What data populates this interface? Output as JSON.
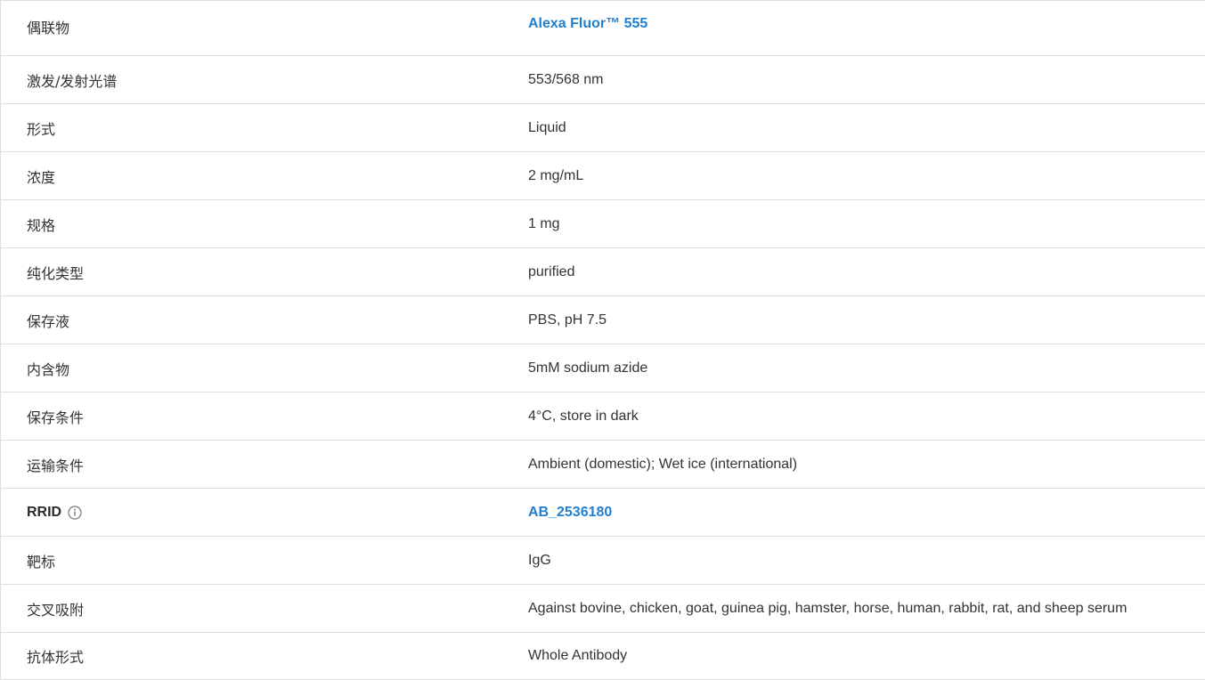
{
  "specs": [
    {
      "label": "偶联物",
      "value": "Alexa Fluor™ 555",
      "link": true
    },
    {
      "label": "激发/发射光谱",
      "value": "553/568 nm",
      "link": false
    },
    {
      "label": "形式",
      "value": "Liquid",
      "link": false
    },
    {
      "label": "浓度",
      "value": "2 mg/mL",
      "link": false
    },
    {
      "label": "规格",
      "value": "1 mg",
      "link": false
    },
    {
      "label": "纯化类型",
      "value": "purified",
      "link": false
    },
    {
      "label": "保存液",
      "value": "PBS, pH 7.5",
      "link": false
    },
    {
      "label": "内含物",
      "value": "5mM sodium azide",
      "link": false
    },
    {
      "label": "保存条件",
      "value": "4°C, store in dark",
      "link": false
    },
    {
      "label": "运输条件",
      "value": "Ambient (domestic); Wet ice (international)",
      "link": false
    },
    {
      "label": "RRID",
      "value": "AB_2536180",
      "link": true,
      "info_icon": "info-icon"
    },
    {
      "label": "靶标",
      "value": "IgG",
      "link": false
    },
    {
      "label": "交叉吸附",
      "value": "Against bovine, chicken, goat, guinea pig, hamster, horse, human, rabbit, rat, and sheep serum",
      "link": false
    },
    {
      "label": "抗体形式",
      "value": "Whole Antibody",
      "link": false
    }
  ],
  "colors": {
    "link": "#1f7fd0",
    "text": "#333333",
    "border": "#dedede"
  }
}
